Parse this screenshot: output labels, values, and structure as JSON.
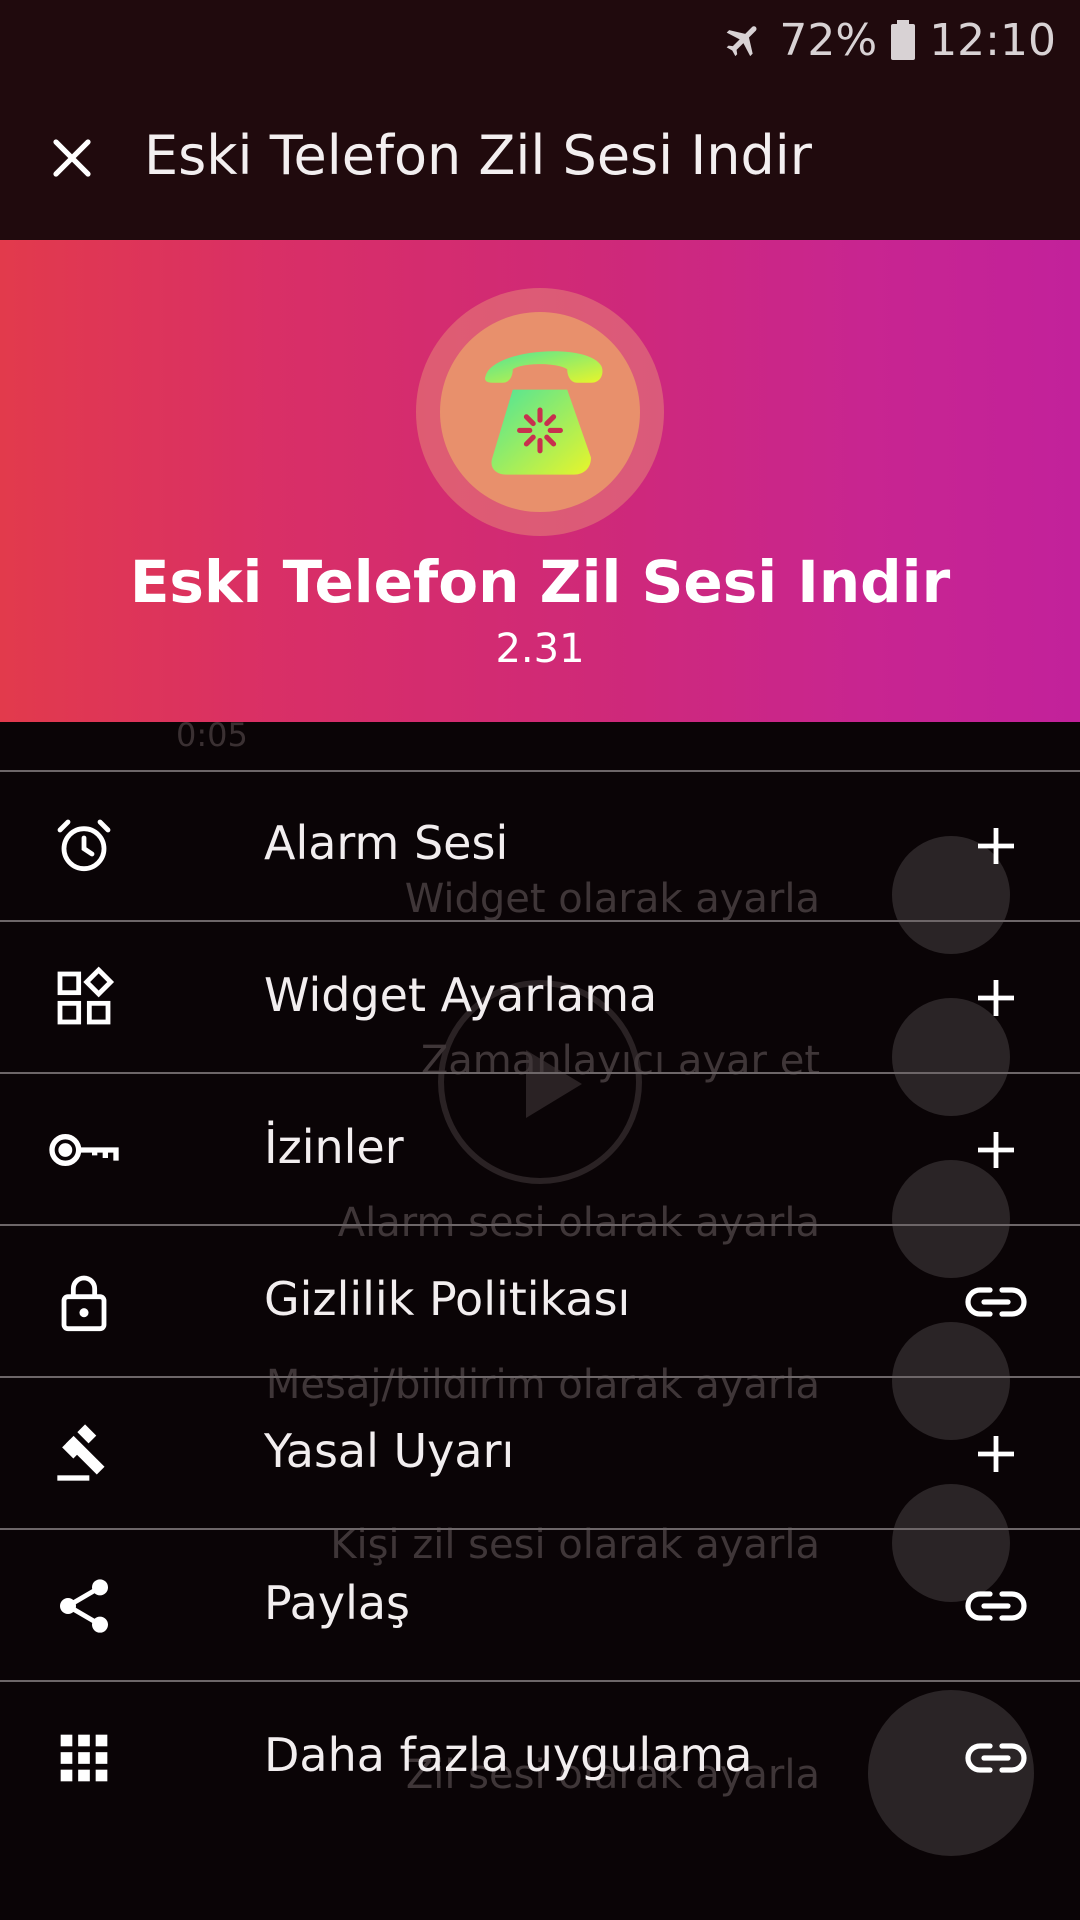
{
  "status_bar": {
    "battery_percent": "72%",
    "time": "12:10",
    "icons": [
      "airplane-mode-icon",
      "battery-icon"
    ]
  },
  "appbar": {
    "close_icon": "close-icon",
    "title": "Eski Telefon Zil Sesi Indir"
  },
  "header": {
    "app_name": "Eski Telefon Zil Sesi Indir",
    "version": "2.31",
    "logo_icon": "old-telephone-icon",
    "gradient_colors": [
      "#e23a4c",
      "#c2219b"
    ]
  },
  "backdrop": {
    "time_readout": "0:05",
    "labels": [
      "Widget olarak ayarla",
      "Zamanlayıcı ayar et",
      "Alarm sesi olarak ayarla",
      "Mesaj/bildirim olarak ayarla",
      "Kişi zil sesi olarak ayarla",
      "Zil sesi olarak ayarla"
    ]
  },
  "menu": {
    "items": [
      {
        "label": "Alarm Sesi",
        "icon": "alarm-clock-icon",
        "action": "plus-icon"
      },
      {
        "label": "Widget Ayarlama",
        "icon": "widgets-icon",
        "action": "plus-icon"
      },
      {
        "label": "İzinler",
        "icon": "key-icon",
        "action": "plus-icon"
      },
      {
        "label": "Gizlilik Politikası",
        "icon": "lock-icon",
        "action": "link-icon"
      },
      {
        "label": "Yasal Uyarı",
        "icon": "gavel-icon",
        "action": "plus-icon"
      },
      {
        "label": "Paylaş",
        "icon": "share-icon",
        "action": "link-icon"
      },
      {
        "label": "Daha fazla uygulama",
        "icon": "apps-grid-icon",
        "action": "link-icon"
      }
    ]
  },
  "colors": {
    "background": "#0a0406",
    "appbar": "#200a0d",
    "divider": "#6d6668",
    "text": "#f2eeef"
  }
}
